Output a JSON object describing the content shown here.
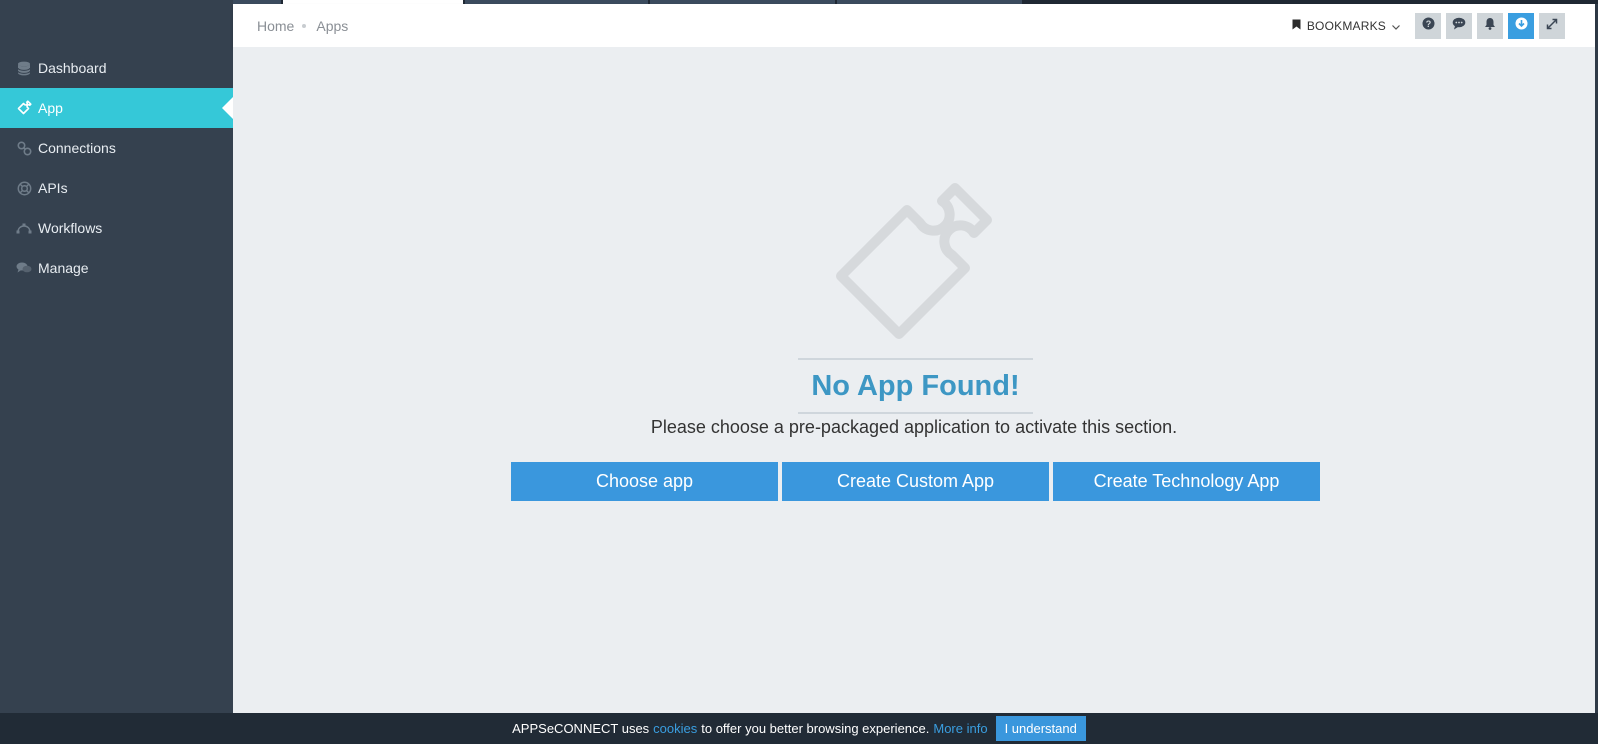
{
  "sidebar": {
    "items": [
      {
        "label": "Dashboard",
        "icon": "database-icon"
      },
      {
        "label": "App",
        "icon": "puzzle-icon",
        "active": true
      },
      {
        "label": "Connections",
        "icon": "link-icon"
      },
      {
        "label": "APIs",
        "icon": "lifebuoy-icon"
      },
      {
        "label": "Workflows",
        "icon": "workflow-icon"
      },
      {
        "label": "Manage",
        "icon": "chat-bubbles-icon"
      }
    ]
  },
  "header": {
    "breadcrumb": {
      "home": "Home",
      "current": "Apps"
    },
    "bookmarks_label": "BOOKMARKS",
    "buttons": [
      "help-icon",
      "comment-icon",
      "bell-icon",
      "download-icon",
      "expand-icon"
    ]
  },
  "main": {
    "empty_icon": "puzzle-icon",
    "title": "No App Found!",
    "subtitle": "Please choose a pre-packaged application to activate this section.",
    "buttons": {
      "choose": "Choose app",
      "custom": "Create Custom App",
      "technology": "Create Technology App"
    }
  },
  "cookie": {
    "text_before": "APPSeCONNECT uses",
    "cookies_link": "cookies",
    "text_after": "to offer you better browsing experience.",
    "more_info": "More info",
    "accept": "I understand"
  },
  "colors": {
    "sidebar_bg": "#35414f",
    "active_item": "#35c8d8",
    "title": "#3d97c4",
    "button": "#3a97dd",
    "main_bg": "#ebeef1"
  }
}
